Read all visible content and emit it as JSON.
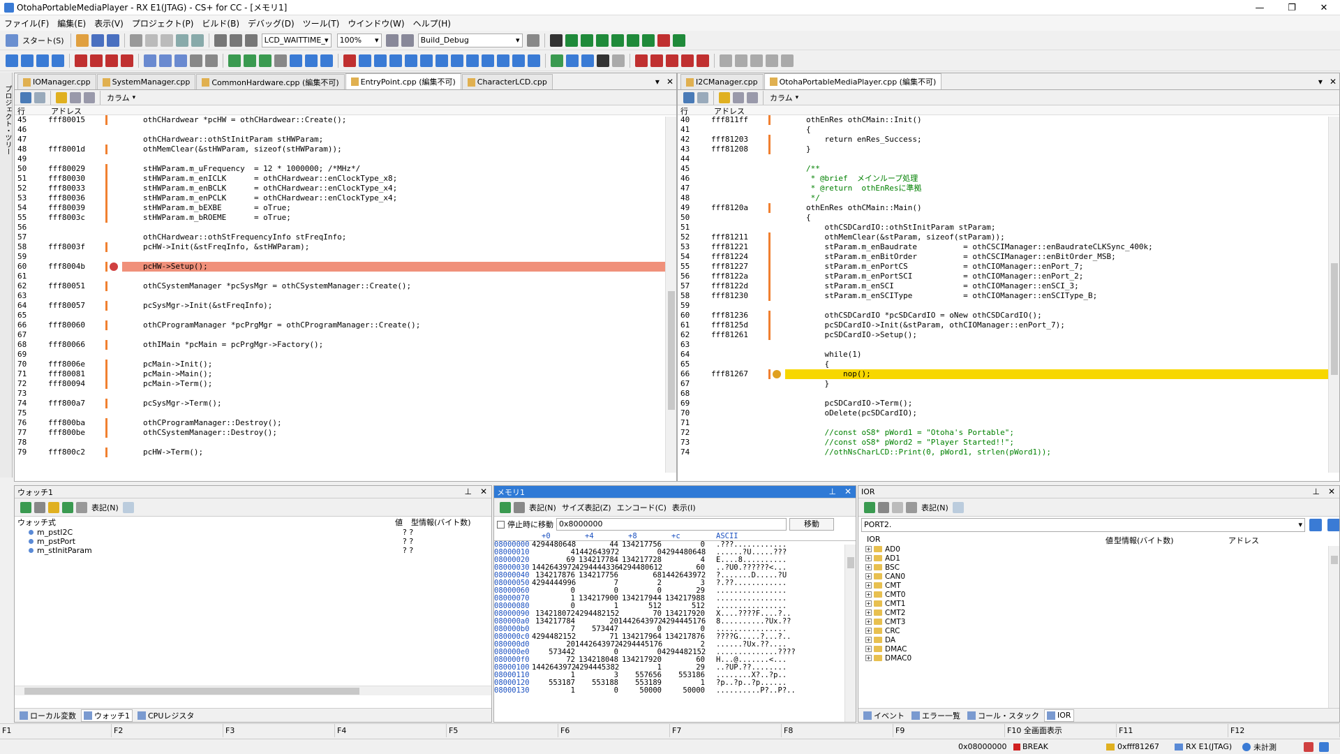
{
  "window": {
    "title": "OtohaPortableMediaPlayer - RX E1(JTAG) - CS+ for CC - [メモリ1]",
    "min": "—",
    "restore": "❐",
    "close": "✕"
  },
  "menu": [
    "ファイル(F)",
    "編集(E)",
    "表示(V)",
    "プロジェクト(P)",
    "ビルド(B)",
    "デバッグ(D)",
    "ツール(T)",
    "ウインドウ(W)",
    "ヘルプ(H)"
  ],
  "toolbar": {
    "start_label": "スタート(S)",
    "combo_config": "LCD_WAITTIME_",
    "combo_zoom": "100%",
    "combo_build": "Build_Debug"
  },
  "side": {
    "label": "プロジェクト・ツリー"
  },
  "left_editor": {
    "tabs": [
      "IOManager.cpp",
      "SystemManager.cpp",
      "CommonHardware.cpp (編集不可)",
      "EntryPoint.cpp (編集不可)",
      "CharacterLCD.cpp"
    ],
    "col_line": "行",
    "col_addr": "アドレス",
    "column_label": "カラム",
    "lines": [
      {
        "n": "45",
        "a": "fff80015",
        "b": 1,
        "t": "othCHardwear *pcHW = othCHardwear::Create();"
      },
      {
        "n": "46",
        "a": "",
        "b": 0,
        "t": ""
      },
      {
        "n": "47",
        "a": "",
        "b": 0,
        "t": "othCHardwear::othStInitParam stHWParam;"
      },
      {
        "n": "48",
        "a": "fff8001d",
        "b": 1,
        "t": "othMemClear(&stHWParam, sizeof(stHWParam));"
      },
      {
        "n": "49",
        "a": "",
        "b": 0,
        "t": ""
      },
      {
        "n": "50",
        "a": "fff80029",
        "b": 1,
        "t": "stHWParam.m_uFrequency  = 12 * 1000000; /*MHz*/"
      },
      {
        "n": "51",
        "a": "fff80030",
        "b": 1,
        "t": "stHWParam.m_enICLK      = othCHardwear::enClockType_x8;"
      },
      {
        "n": "52",
        "a": "fff80033",
        "b": 1,
        "t": "stHWParam.m_enBCLK      = othCHardwear::enClockType_x4;"
      },
      {
        "n": "53",
        "a": "fff80036",
        "b": 1,
        "t": "stHWParam.m_enPCLK      = othCHardwear::enClockType_x4;"
      },
      {
        "n": "54",
        "a": "fff80039",
        "b": 1,
        "t": "stHWParam.m_bEXBE       = oTrue;"
      },
      {
        "n": "55",
        "a": "fff8003c",
        "b": 1,
        "t": "stHWParam.m_bROEME      = oTrue;"
      },
      {
        "n": "56",
        "a": "",
        "b": 0,
        "t": ""
      },
      {
        "n": "57",
        "a": "",
        "b": 0,
        "t": "othCHardwear::othStFrequencyInfo stFreqInfo;"
      },
      {
        "n": "58",
        "a": "fff8003f",
        "b": 1,
        "t": "pcHW->Init(&stFreqInfo, &stHWParam);"
      },
      {
        "n": "59",
        "a": "",
        "b": 0,
        "t": ""
      },
      {
        "n": "60",
        "a": "fff8004b",
        "b": 1,
        "t": "pcHW->Setup();",
        "hl": "red"
      },
      {
        "n": "61",
        "a": "",
        "b": 0,
        "t": ""
      },
      {
        "n": "62",
        "a": "fff80051",
        "b": 1,
        "t": "othCSystemManager *pcSysMgr = othCSystemManager::Create();"
      },
      {
        "n": "63",
        "a": "",
        "b": 0,
        "t": ""
      },
      {
        "n": "64",
        "a": "fff80057",
        "b": 1,
        "t": "pcSysMgr->Init(&stFreqInfo);"
      },
      {
        "n": "65",
        "a": "",
        "b": 0,
        "t": ""
      },
      {
        "n": "66",
        "a": "fff80060",
        "b": 1,
        "t": "othCProgramManager *pcPrgMgr = othCProgramManager::Create();"
      },
      {
        "n": "67",
        "a": "",
        "b": 0,
        "t": ""
      },
      {
        "n": "68",
        "a": "fff80066",
        "b": 1,
        "t": "othIMain *pcMain = pcPrgMgr->Factory();"
      },
      {
        "n": "69",
        "a": "",
        "b": 0,
        "t": ""
      },
      {
        "n": "70",
        "a": "fff8006e",
        "b": 1,
        "t": "pcMain->Init();"
      },
      {
        "n": "71",
        "a": "fff80081",
        "b": 1,
        "t": "pcMain->Main();"
      },
      {
        "n": "72",
        "a": "fff80094",
        "b": 1,
        "t": "pcMain->Term();"
      },
      {
        "n": "73",
        "a": "",
        "b": 0,
        "t": ""
      },
      {
        "n": "74",
        "a": "fff800a7",
        "b": 1,
        "t": "pcSysMgr->Term();"
      },
      {
        "n": "75",
        "a": "",
        "b": 0,
        "t": ""
      },
      {
        "n": "76",
        "a": "fff800ba",
        "b": 1,
        "t": "othCProgramManager::Destroy();"
      },
      {
        "n": "77",
        "a": "fff800be",
        "b": 1,
        "t": "othCSystemManager::Destroy();"
      },
      {
        "n": "78",
        "a": "",
        "b": 0,
        "t": ""
      },
      {
        "n": "79",
        "a": "fff800c2",
        "b": 1,
        "t": "pcHW->Term();"
      }
    ]
  },
  "right_editor": {
    "tabs": [
      "I2CManager.cpp",
      "OtohaPortableMediaPlayer.cpp (編集不可)"
    ],
    "col_line": "行",
    "col_addr": "アドレス",
    "column_label": "カラム",
    "lines": [
      {
        "n": "40",
        "a": "fff811ff",
        "b": 1,
        "t": "othEnRes othCMain::Init()"
      },
      {
        "n": "41",
        "a": "",
        "b": 0,
        "t": "{"
      },
      {
        "n": "42",
        "a": "fff81203",
        "b": 1,
        "t": "    return enRes_Success;"
      },
      {
        "n": "43",
        "a": "fff81208",
        "b": 1,
        "t": "}"
      },
      {
        "n": "44",
        "a": "",
        "b": 0,
        "t": ""
      },
      {
        "n": "45",
        "a": "",
        "b": 0,
        "t": "/**"
      },
      {
        "n": "46",
        "a": "",
        "b": 0,
        "t": " * @brief  メインループ処理"
      },
      {
        "n": "47",
        "a": "",
        "b": 0,
        "t": " * @return  othEnResに準拠"
      },
      {
        "n": "48",
        "a": "",
        "b": 0,
        "t": " */"
      },
      {
        "n": "49",
        "a": "fff8120a",
        "b": 1,
        "t": "othEnRes othCMain::Main()"
      },
      {
        "n": "50",
        "a": "",
        "b": 0,
        "t": "{"
      },
      {
        "n": "51",
        "a": "",
        "b": 0,
        "t": "    othCSDCardIO::othStInitParam stParam;"
      },
      {
        "n": "52",
        "a": "fff81211",
        "b": 1,
        "t": "    othMemClear(&stParam, sizeof(stParam));"
      },
      {
        "n": "53",
        "a": "fff81221",
        "b": 1,
        "t": "    stParam.m_enBaudrate          = othCSCIManager::enBaudrateCLKSync_400k;"
      },
      {
        "n": "54",
        "a": "fff81224",
        "b": 1,
        "t": "    stParam.m_enBitOrder          = othCSCIManager::enBitOrder_MSB;"
      },
      {
        "n": "55",
        "a": "fff81227",
        "b": 1,
        "t": "    stParam.m_enPortCS            = othCIOManager::enPort_7;"
      },
      {
        "n": "56",
        "a": "fff8122a",
        "b": 1,
        "t": "    stParam.m_enPortSCI           = othCIOManager::enPort_2;"
      },
      {
        "n": "57",
        "a": "fff8122d",
        "b": 1,
        "t": "    stParam.m_enSCI               = othCIOManager::enSCI_3;"
      },
      {
        "n": "58",
        "a": "fff81230",
        "b": 1,
        "t": "    stParam.m_enSCIType           = othCIOManager::enSCIType_B;"
      },
      {
        "n": "59",
        "a": "",
        "b": 0,
        "t": ""
      },
      {
        "n": "60",
        "a": "fff81236",
        "b": 1,
        "t": "    othCSDCardIO *pcSDCardIO = oNew othCSDCardIO();"
      },
      {
        "n": "61",
        "a": "fff8125d",
        "b": 1,
        "t": "    pcSDCardIO->Init(&stParam, othCIOManager::enPort_7);"
      },
      {
        "n": "62",
        "a": "fff81261",
        "b": 1,
        "t": "    pcSDCardIO->Setup();"
      },
      {
        "n": "63",
        "a": "",
        "b": 0,
        "t": ""
      },
      {
        "n": "64",
        "a": "",
        "b": 0,
        "t": "    while(1)"
      },
      {
        "n": "65",
        "a": "",
        "b": 0,
        "t": "    {"
      },
      {
        "n": "66",
        "a": "fff81267",
        "b": 1,
        "t": "        nop();",
        "hl": "yel"
      },
      {
        "n": "67",
        "a": "",
        "b": 0,
        "t": "    }"
      },
      {
        "n": "68",
        "a": "",
        "b": 0,
        "t": ""
      },
      {
        "n": "69",
        "a": "",
        "b": 0,
        "t": "    pcSDCardIO->Term();"
      },
      {
        "n": "70",
        "a": "",
        "b": 0,
        "t": "    oDelete(pcSDCardIO);"
      },
      {
        "n": "71",
        "a": "",
        "b": 0,
        "t": ""
      },
      {
        "n": "72",
        "a": "",
        "b": 0,
        "t": "    //const oS8* pWord1 = \"Otoha's Portable\";"
      },
      {
        "n": "73",
        "a": "",
        "b": 0,
        "t": "    //const oS8* pWord2 = \"Player Started!!\";"
      },
      {
        "n": "74",
        "a": "",
        "b": 0,
        "t": "    //othNsCharLCD::Print(0, pWord1, strlen(pWord1));"
      }
    ]
  },
  "watch": {
    "title": "ウォッチ1",
    "view_label": "表記(N)",
    "col_expr": "ウォッチ式",
    "col_value": "値",
    "col_type": "型情報(バイト数)",
    "items": [
      {
        "name": "m_pstI2C",
        "value": "? ?"
      },
      {
        "name": "m_pstPort",
        "value": "? ?"
      },
      {
        "name": "m_stInitParam",
        "value": "? ?"
      }
    ],
    "bottom_tabs": [
      "ローカル変数",
      "ウォッチ1",
      "CPUレジスタ"
    ]
  },
  "memory": {
    "title": "メモリ1",
    "view_label": "表記(N)",
    "size_label": "サイズ表記(Z)",
    "encode_label": "エンコード(C)",
    "display_label": "表示(I)",
    "stop_move_label": "停止時に移動",
    "address_value": "0x8000000",
    "move_button": "移動",
    "cols": [
      "+0",
      "+4",
      "+8",
      "+c",
      "ASCII"
    ],
    "rows": [
      [
        "08000000",
        "4294480648",
        "44",
        "134217756",
        "0",
        ".???............"
      ],
      [
        "08000010",
        "4",
        "1442643972",
        "0",
        "4294480648",
        "......?U.....???"
      ],
      [
        "08000020",
        "69",
        "134217784",
        "134217728",
        "4",
        "E....8.........."
      ],
      [
        "08000030",
        "1442643972",
        "4294444336",
        "4294480612",
        "60",
        "..?U0.??????<..."
      ],
      [
        "08000040",
        "134217876",
        "134217756",
        "68",
        "1442643972",
        "?.......D.....?U"
      ],
      [
        "08000050",
        "4294444996",
        "7",
        "2",
        "3",
        "?.??............"
      ],
      [
        "08000060",
        "0",
        "0",
        "0",
        "29",
        "................"
      ],
      [
        "08000070",
        "1",
        "134217900",
        "134217944",
        "134217988",
        "................"
      ],
      [
        "08000080",
        "0",
        "1",
        "512",
        "512",
        "................"
      ],
      [
        "08000090",
        "134218072",
        "4294482152",
        "70",
        "134217920",
        "X....????F....?.."
      ],
      [
        "080000a0",
        "134217784",
        "20",
        "1442643972",
        "4294445176",
        "8..........?Ux.??"
      ],
      [
        "080000b0",
        "7",
        "573447",
        "0",
        "0",
        "................"
      ],
      [
        "080000c0",
        "4294482152",
        "71",
        "134217964",
        "134217876",
        "????G.....?...?.."
      ],
      [
        "080000d0",
        "20",
        "1442643972",
        "4294445176",
        "2",
        "......?Ux.??...."
      ],
      [
        "080000e0",
        "573442",
        "0",
        "0",
        "4294482152",
        "..............????"
      ],
      [
        "080000f0",
        "72",
        "134218048",
        "134217920",
        "60",
        "H...@.......<..."
      ],
      [
        "08000100",
        "1442643972",
        "4294445382",
        "1",
        "29",
        "..?UP.??........"
      ],
      [
        "08000110",
        "1",
        "3",
        "557656",
        "553186",
        "........X?..?p.."
      ],
      [
        "08000120",
        "553187",
        "553188",
        "553189",
        "1",
        "?p..?p..?p......"
      ],
      [
        "08000130",
        "1",
        "0",
        "50000",
        "50000",
        "..........P?..P?.."
      ]
    ]
  },
  "ior": {
    "title": "IOR",
    "view_label": "表記(N)",
    "combo_value": "PORT2.",
    "col_name": "IOR",
    "col_value": "値",
    "col_type": "型情報(バイト数)",
    "col_addr": "アドレス",
    "items": [
      "AD0",
      "AD1",
      "BSC",
      "CAN0",
      "CMT",
      "CMT0",
      "CMT1",
      "CMT2",
      "CMT3",
      "CRC",
      "DA",
      "DMAC",
      "DMAC0"
    ],
    "bottom_tabs": [
      "イベント",
      "エラー一覧",
      "コール・スタック",
      "IOR"
    ]
  },
  "fkeys": [
    "F1",
    "F2",
    "F3",
    "F4",
    "F5",
    "F6",
    "F7",
    "F8",
    "F9",
    "F10 全画面表示",
    "F11",
    "F12"
  ],
  "status": {
    "address": "0x08000000",
    "state": "BREAK",
    "pc": "0xfff81267",
    "target": "RX E1(JTAG)",
    "timer": "未計測"
  }
}
